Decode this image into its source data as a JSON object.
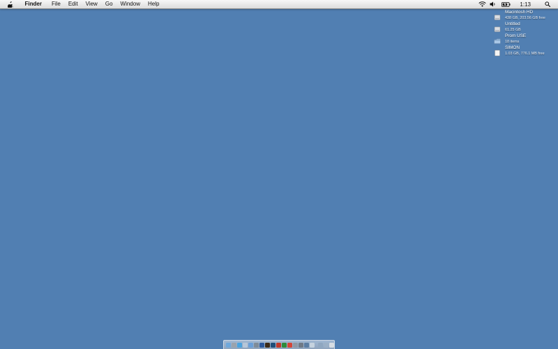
{
  "menubar": {
    "app_name": "Finder",
    "menus": [
      "File",
      "Edit",
      "View",
      "Go",
      "Window",
      "Help"
    ],
    "clock": "1:13",
    "status_icons": [
      "wifi-icon",
      "volume-icon",
      "battery-icon",
      "spotlight-icon"
    ]
  },
  "desktop": {
    "background_color": "#517fb2",
    "volumes": [
      {
        "name": "Macintosh HD",
        "info": "438 GB, 203.56 GB free",
        "icon": "hard-drive-icon"
      },
      {
        "name": "Untitled",
        "info": "61.25 GB",
        "icon": "hard-drive-icon"
      },
      {
        "name": "Prom USE",
        "info": "18 items",
        "icon": "folder-icon"
      },
      {
        "name": "SIMON",
        "info": "1.03 GB, 776.1 MB free",
        "icon": "external-drive-icon"
      }
    ]
  },
  "dock": {
    "items": [
      {
        "name": "finder-icon",
        "color": "#6fa8dc"
      },
      {
        "name": "dashboard-icon",
        "color": "#9aa3ad"
      },
      {
        "name": "safari-icon",
        "color": "#4aa3df"
      },
      {
        "name": "mail-icon",
        "color": "#b6c6d8"
      },
      {
        "name": "itunes-icon",
        "color": "#6a9fd8"
      },
      {
        "name": "iphoto-icon",
        "color": "#7f8c99"
      },
      {
        "name": "word-icon",
        "color": "#2b579a"
      },
      {
        "name": "bridge-icon",
        "color": "#3b2a18"
      },
      {
        "name": "photoshop-icon",
        "color": "#1f4e79"
      },
      {
        "name": "sketch-icon",
        "color": "#c0392b"
      },
      {
        "name": "excel-icon",
        "color": "#2e8b3c"
      },
      {
        "name": "chrome-icon",
        "color": "#d44638"
      },
      {
        "name": "utility-icon",
        "color": "#8e98a4"
      },
      {
        "name": "preferences-icon",
        "color": "#707a86"
      },
      {
        "name": "app-icon",
        "color": "#5c7ea3"
      },
      {
        "name": "preview-icon",
        "color": "#c6d3df"
      },
      {
        "name": "downloads-icon",
        "color": "#8fa7c0"
      },
      {
        "name": "documents-icon",
        "color": "#9bb0c6"
      },
      {
        "name": "trash-icon",
        "color": "#d7dde3"
      }
    ]
  }
}
